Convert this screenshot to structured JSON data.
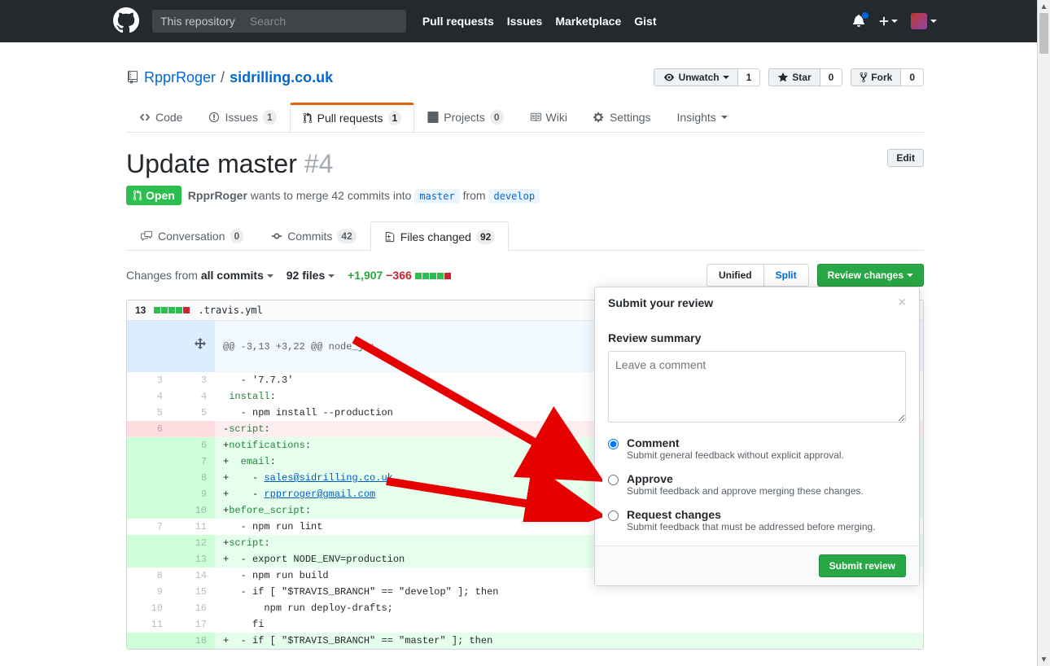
{
  "topnav": {
    "scope": "This repository",
    "search_placeholder": "Search",
    "links": [
      "Pull requests",
      "Issues",
      "Marketplace",
      "Gist"
    ]
  },
  "repo": {
    "owner": "RpprRoger",
    "name": "sidrilling.co.uk",
    "actions": {
      "unwatch": "Unwatch",
      "unwatch_count": "1",
      "star": "Star",
      "star_count": "0",
      "fork": "Fork",
      "fork_count": "0"
    }
  },
  "reponav": {
    "code": "Code",
    "issues": "Issues",
    "issues_count": "1",
    "pr": "Pull requests",
    "pr_count": "1",
    "projects": "Projects",
    "projects_count": "0",
    "wiki": "Wiki",
    "settings": "Settings",
    "insights": "Insights"
  },
  "pr": {
    "title": "Update master",
    "number": "#4",
    "edit": "Edit",
    "state": "Open",
    "author": "RpprRoger",
    "merge_text_1": " wants to merge 42 commits into ",
    "base": "master",
    "merge_text_2": " from ",
    "head": "develop"
  },
  "prtabs": {
    "conversation": "Conversation",
    "conversation_count": "0",
    "commits": "Commits",
    "commits_count": "42",
    "files": "Files changed",
    "files_count": "92"
  },
  "difftool": {
    "changes_from": "Changes from ",
    "all_commits": "all commits",
    "files": "92 files",
    "additions": "+1,907",
    "deletions": "−366",
    "unified": "Unified",
    "split": "Split",
    "review_btn": "Review changes"
  },
  "file": {
    "count": "13",
    "name": ".travis.yml",
    "hunk": "@@ -3,13 +3,22 @@ node_js:"
  },
  "diff_rows": [
    {
      "t": "ctx",
      "l": "3",
      "r": "3",
      "m": " ",
      "c": "  - '7.7.3'"
    },
    {
      "t": "ctx",
      "l": "4",
      "r": "4",
      "m": " ",
      "c": "install:",
      "k": 1
    },
    {
      "t": "ctx",
      "l": "5",
      "r": "5",
      "m": " ",
      "c": "  - npm install --production"
    },
    {
      "t": "del",
      "l": "6",
      "r": "",
      "m": "-",
      "c": "script:",
      "k": 1
    },
    {
      "t": "add",
      "l": "",
      "r": "6",
      "m": "+",
      "c": "notifications:",
      "k": 1
    },
    {
      "t": "add",
      "l": "",
      "r": "7",
      "m": "+",
      "c": "  email:",
      "k": 1
    },
    {
      "t": "add",
      "l": "",
      "r": "8",
      "m": "+",
      "c": "    - ",
      "lnk": "sales@sidrilling.co.uk"
    },
    {
      "t": "add",
      "l": "",
      "r": "9",
      "m": "+",
      "c": "    - ",
      "lnk": "rpprroger@gmail.com"
    },
    {
      "t": "add",
      "l": "",
      "r": "10",
      "m": "+",
      "c": "before_script:",
      "k": 1
    },
    {
      "t": "ctx",
      "l": "7",
      "r": "11",
      "m": " ",
      "c": "  - npm run lint"
    },
    {
      "t": "add",
      "l": "",
      "r": "12",
      "m": "+",
      "c": "script:",
      "k": 1
    },
    {
      "t": "add",
      "l": "",
      "r": "13",
      "m": "+",
      "c": "  - export NODE_ENV=production"
    },
    {
      "t": "ctx",
      "l": "8",
      "r": "14",
      "m": " ",
      "c": "  - npm run build"
    },
    {
      "t": "ctx",
      "l": "9",
      "r": "15",
      "m": " ",
      "c": "  - if [ \"$TRAVIS_BRANCH\" == \"develop\" ]; then"
    },
    {
      "t": "ctx",
      "l": "10",
      "r": "16",
      "m": " ",
      "c": "      npm run deploy-drafts;"
    },
    {
      "t": "ctx",
      "l": "11",
      "r": "17",
      "m": " ",
      "c": "    fi"
    },
    {
      "t": "add",
      "l": "",
      "r": "18",
      "m": "+",
      "c": "  - if [ \"$TRAVIS_BRANCH\" == \"master\" ]; then"
    }
  ],
  "review": {
    "title": "Submit your review",
    "summary_label": "Review summary",
    "placeholder": "Leave a comment",
    "opts": {
      "comment_t": "Comment",
      "comment_d": "Submit general feedback without explicit approval.",
      "approve_t": "Approve",
      "approve_d": "Submit feedback and approve merging these changes.",
      "request_t": "Request changes",
      "request_d": "Submit feedback that must be addressed before merging."
    },
    "submit": "Submit review"
  }
}
